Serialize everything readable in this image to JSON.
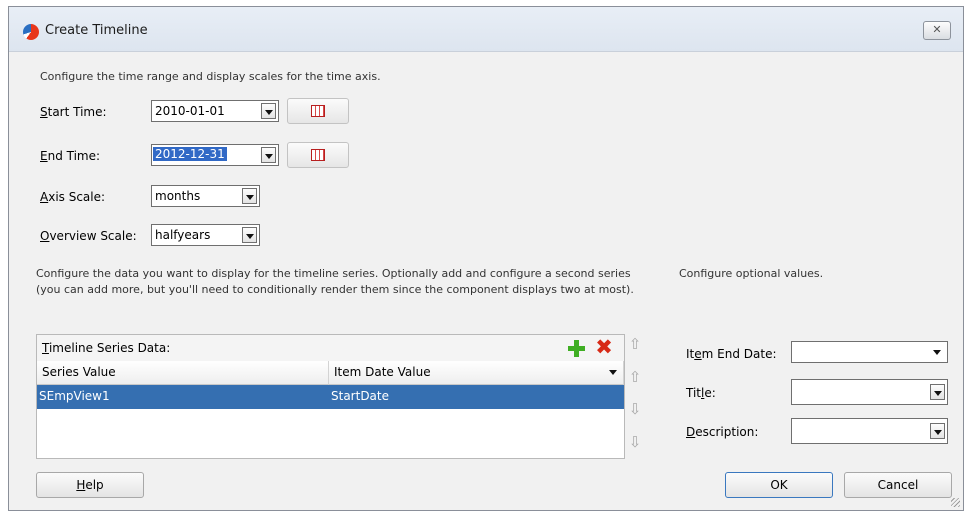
{
  "window": {
    "title": "Create Timeline",
    "close_label": "✕"
  },
  "intro": "Configure the time range and display scales for the time axis.",
  "fields": {
    "start_time": {
      "label_ul": "S",
      "label_rest": "tart Time:",
      "value": "2010-01-01"
    },
    "end_time": {
      "label_ul": "E",
      "label_rest": "nd Time:",
      "value": "2012-12-31"
    },
    "axis_scale": {
      "label_ul": "A",
      "label_rest": "xis Scale:",
      "value": "months"
    },
    "overview_scale": {
      "label_ul": "O",
      "label_rest": "verview Scale:",
      "value": "halfyears"
    }
  },
  "series_instructions": "Configure the data you want to display for the timeline series. Optionally add and configure a second series (you can add more, but you'll need to conditionally render them since the component displays two at most).",
  "table": {
    "label_ul": "T",
    "label_rest": "imeline Series Data:",
    "columns": [
      "Series Value",
      "Item Date Value"
    ],
    "rows": [
      {
        "series_value": "SEmpView1",
        "item_date_value": "StartDate"
      }
    ]
  },
  "optional": {
    "heading": "Configure optional values.",
    "item_end_date": {
      "label_pre": "It",
      "label_ul": "e",
      "label_post": "m End Date:",
      "value": ""
    },
    "title": {
      "label_pre": "Tit",
      "label_ul": "l",
      "label_post": "e:",
      "value": ""
    },
    "description": {
      "label_pre": "",
      "label_ul": "D",
      "label_post": "escription:",
      "value": ""
    }
  },
  "buttons": {
    "help_ul": "H",
    "help_rest": "elp",
    "ok": "OK",
    "cancel": "Cancel"
  }
}
